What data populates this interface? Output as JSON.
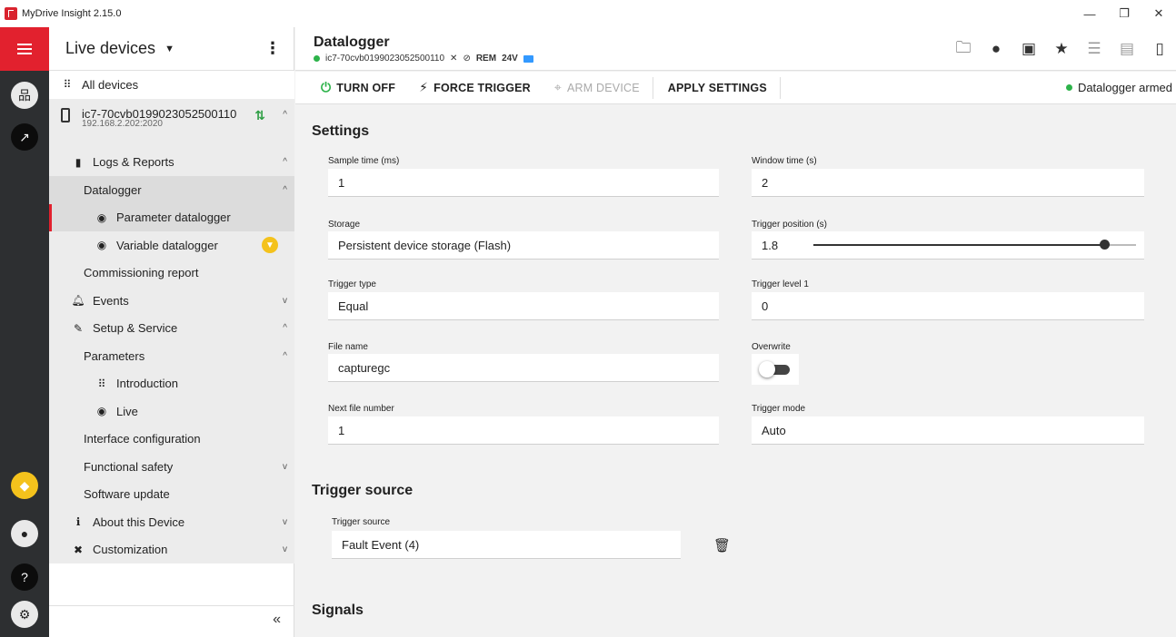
{
  "window": {
    "title": "MyDrive Insight 2.15.0"
  },
  "side": {
    "title": "Live devices",
    "all_devices": "All devices",
    "device": {
      "name": "ic7-70cvb0199023052500110",
      "ip": "192.168.2.202:2020"
    },
    "items": {
      "logs": "Logs & Reports",
      "datalogger": "Datalogger",
      "param_dl": "Parameter datalogger",
      "var_dl": "Variable datalogger",
      "commissioning": "Commissioning report",
      "events": "Events",
      "setup": "Setup & Service",
      "parameters": "Parameters",
      "introduction": "Introduction",
      "live": "Live",
      "interface": "Interface configuration",
      "safety": "Functional safety",
      "software": "Software update",
      "about": "About this Device",
      "custom": "Customization"
    }
  },
  "header": {
    "title": "Datalogger",
    "device": "ic7-70cvb0199023052500110",
    "rem": "REM",
    "voltage": "24V"
  },
  "toolbar": {
    "turn_off": "TURN OFF",
    "force_trigger": "FORCE TRIGGER",
    "arm_device": "ARM DEVICE",
    "apply_settings": "APPLY SETTINGS",
    "status": "Datalogger armed"
  },
  "settings": {
    "heading": "Settings",
    "sample_time": {
      "label": "Sample time (ms)",
      "value": "1"
    },
    "window_time": {
      "label": "Window time (s)",
      "value": "2"
    },
    "storage": {
      "label": "Storage",
      "value": "Persistent device storage (Flash)"
    },
    "trigger_position": {
      "label": "Trigger position (s)",
      "value": "1.8",
      "fraction": 0.9
    },
    "trigger_type": {
      "label": "Trigger type",
      "value": "Equal"
    },
    "trigger_level": {
      "label": "Trigger level 1",
      "value": "0"
    },
    "file_name": {
      "label": "File name",
      "value": "capturegc"
    },
    "overwrite": {
      "label": "Overwrite",
      "on": false
    },
    "next_file": {
      "label": "Next file number",
      "value": "1"
    },
    "trigger_mode": {
      "label": "Trigger mode",
      "value": "Auto"
    }
  },
  "trigger_source": {
    "heading": "Trigger source",
    "label": "Trigger source",
    "value": "Fault Event (4)"
  },
  "signals": {
    "heading": "Signals"
  }
}
